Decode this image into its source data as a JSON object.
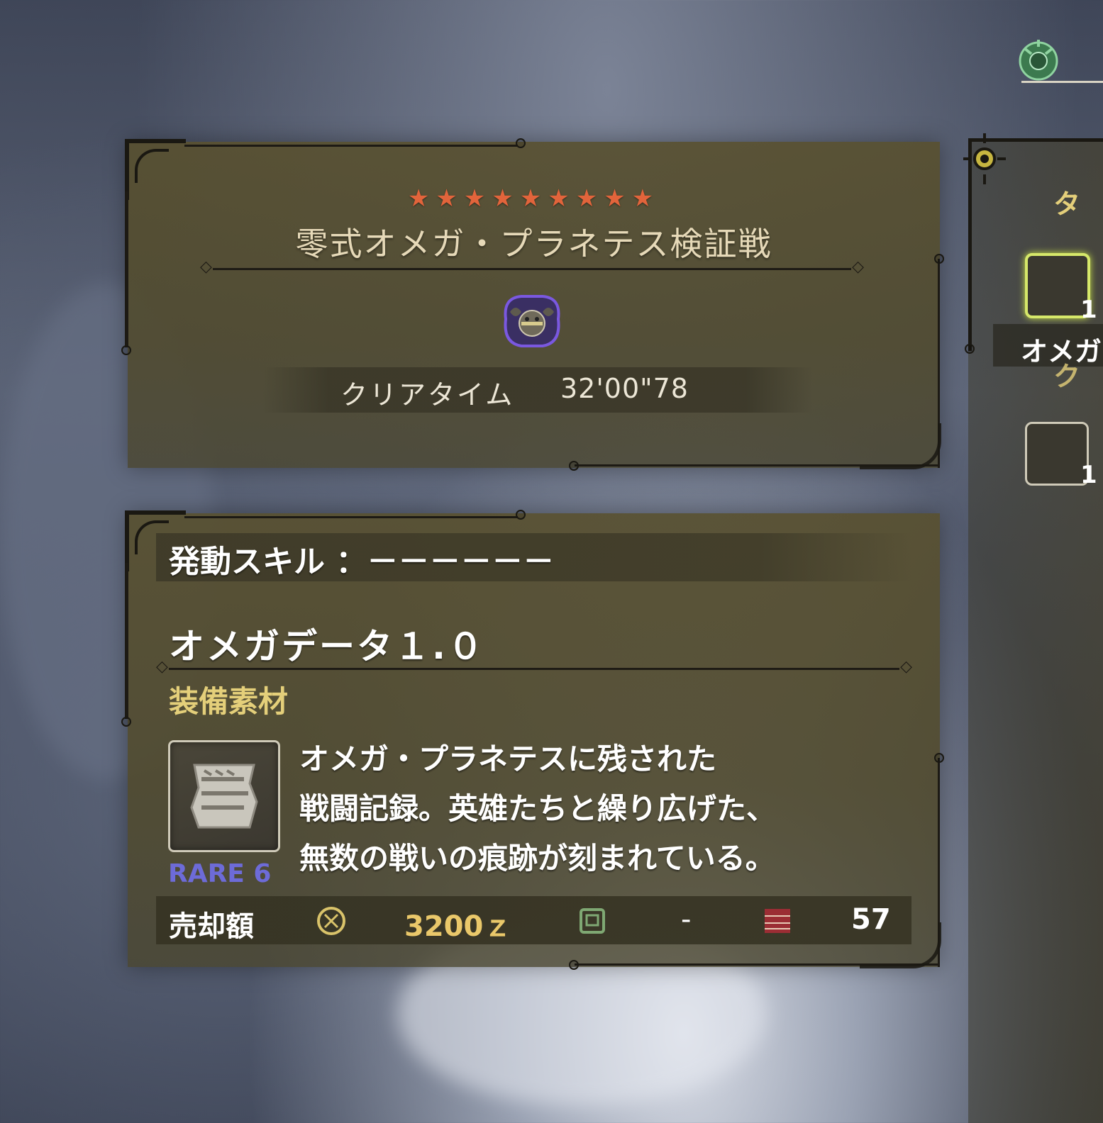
{
  "quest": {
    "stars": "★★★★★★★★★",
    "title": "零式オメガ・プラネテス検証戦",
    "clear_time_label": "クリアタイム",
    "clear_time_value": "32'00\"78"
  },
  "item": {
    "skill_line": "発動スキル ：－－－－－－",
    "name": "オメガデータ１.０",
    "category": "装備素材",
    "rarity": "RARE 6",
    "description": [
      "オメガ・プラネテスに残された",
      "戦闘記録。英雄たちと繰り広げた、",
      "無数の戦いの痕跡が刻まれている。"
    ],
    "sell_label": "売却額",
    "sell_price": "3200ｚ",
    "points_value": "-",
    "owned_count": "57"
  },
  "side": {
    "header_partial": "タ",
    "item_partial": "オメガ",
    "sub_partial": "ク",
    "count_1": "1",
    "count_2": "1"
  },
  "colors": {
    "stars": "#e2643b",
    "rarity": "#6d6bd8",
    "category": "#e4cf7a",
    "price": "#eac86a"
  }
}
